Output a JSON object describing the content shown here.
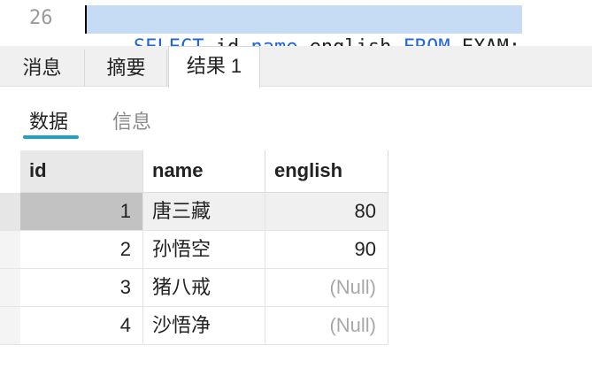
{
  "editor": {
    "line_number": "26",
    "tokens": [
      {
        "text": "SELECT",
        "kind": "kw"
      },
      {
        "text": " id,",
        "kind": "id"
      },
      {
        "text": "name",
        "kind": "kw"
      },
      {
        "text": ",english ",
        "kind": "id"
      },
      {
        "text": "FROM",
        "kind": "kw"
      },
      {
        "text": " EXAM;",
        "kind": "id"
      }
    ]
  },
  "tabs": [
    "消息",
    "摘要",
    "结果 1"
  ],
  "subtabs": [
    "数据",
    "信息"
  ],
  "grid": {
    "columns": [
      "id",
      "name",
      "english"
    ],
    "rows": [
      {
        "id": "1",
        "name": "唐三藏",
        "english": "80"
      },
      {
        "id": "2",
        "name": "孙悟空",
        "english": "90"
      },
      {
        "id": "3",
        "name": "猪八戒",
        "english": "(Null)"
      },
      {
        "id": "4",
        "name": "沙悟净",
        "english": "(Null)"
      }
    ]
  },
  "colors": {
    "keyword": "#1f66d6",
    "selection": "#c6dcf4",
    "accent": "#21a0c8",
    "null_text": "#a8a8a8"
  }
}
